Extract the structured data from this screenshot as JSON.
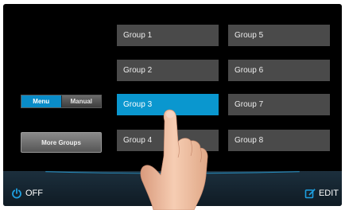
{
  "mode_toggle": {
    "menu_label": "Menu",
    "manual_label": "Manual",
    "active": "Menu"
  },
  "more_groups_label": "More Groups",
  "groups": [
    {
      "label": "Group 1",
      "selected": false
    },
    {
      "label": "Group 2",
      "selected": false
    },
    {
      "label": "Group 3",
      "selected": true
    },
    {
      "label": "Group 4",
      "selected": false
    },
    {
      "label": "Group 5",
      "selected": false
    },
    {
      "label": "Group 6",
      "selected": false
    },
    {
      "label": "Group 7",
      "selected": false
    },
    {
      "label": "Group 8",
      "selected": false
    }
  ],
  "bottom_bar": {
    "off_label": "OFF",
    "edit_label": "EDIT"
  },
  "colors": {
    "accent": "#0a97cf",
    "button": "#4a4a4a",
    "background": "#000000",
    "icon": "#1e9fe0"
  },
  "icons": {
    "power": "power-icon",
    "edit": "edit-icon"
  }
}
